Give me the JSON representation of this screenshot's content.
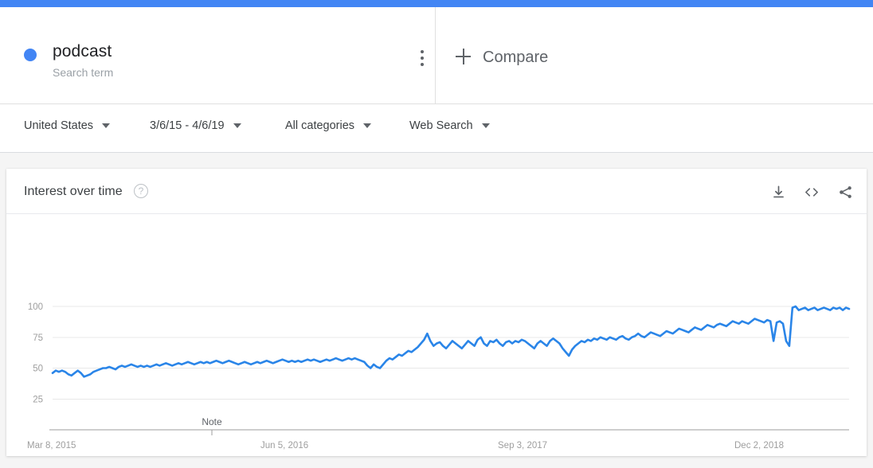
{
  "theme": {
    "accent": "#4285f4",
    "line_color": "#2a85e8",
    "page_bg": "#f5f5f5",
    "card_bg": "#ffffff",
    "grid_color": "#e8e8e8",
    "muted_text": "#9e9e9e"
  },
  "search_term": {
    "name": "podcast",
    "subtitle": "Search term",
    "dot_color": "#4285f4",
    "menu_icon": "three-dots-vertical-icon"
  },
  "compare": {
    "label": "Compare",
    "icon": "plus-icon"
  },
  "filters": [
    {
      "id": "region",
      "label": "United States",
      "icon": "chevron-down-icon"
    },
    {
      "id": "time",
      "label": "3/6/15 - 4/6/19",
      "icon": "chevron-down-icon"
    },
    {
      "id": "category",
      "label": "All categories",
      "icon": "chevron-down-icon"
    },
    {
      "id": "type",
      "label": "Web Search",
      "icon": "chevron-down-icon"
    }
  ],
  "card": {
    "title": "Interest over time",
    "help_icon": "question-mark-circle-icon",
    "help_glyph": "?",
    "actions": [
      {
        "id": "download",
        "icon": "download-icon",
        "tooltip": "Download"
      },
      {
        "id": "embed",
        "icon": "embed-code-icon",
        "tooltip": "Embed"
      },
      {
        "id": "share",
        "icon": "share-icon",
        "tooltip": "Share"
      }
    ]
  },
  "chart_data": {
    "type": "line",
    "title": "Interest over time",
    "xlabel": "",
    "ylabel": "",
    "ylim": [
      0,
      100
    ],
    "yticks": [
      25,
      50,
      75,
      100
    ],
    "ytick_labels": [
      "25",
      "75",
      "50",
      "100"
    ],
    "grid": true,
    "legend": false,
    "series_name": "podcast",
    "x_tick_labels": [
      "Mar 8, 2015",
      "Jun 5, 2016",
      "Sep 3, 2017",
      "Dec 2, 2018"
    ],
    "x_tick_positions": [
      0,
      0.295,
      0.593,
      0.89
    ],
    "x_range": [
      "Mar 8, 2015",
      "Apr 6, 2019"
    ],
    "annotations": [
      {
        "label": "Note",
        "x_fraction": 0.2
      }
    ],
    "values": [
      46,
      48,
      47,
      48,
      47,
      45,
      44,
      46,
      48,
      46,
      43,
      44,
      45,
      47,
      48,
      49,
      50,
      50,
      51,
      50,
      49,
      51,
      52,
      51,
      52,
      53,
      52,
      51,
      52,
      51,
      52,
      51,
      52,
      53,
      52,
      53,
      54,
      53,
      52,
      53,
      54,
      53,
      54,
      55,
      54,
      53,
      54,
      55,
      54,
      55,
      54,
      55,
      56,
      55,
      54,
      55,
      56,
      55,
      54,
      53,
      54,
      55,
      54,
      53,
      54,
      55,
      54,
      55,
      56,
      55,
      54,
      55,
      56,
      57,
      56,
      55,
      56,
      55,
      56,
      55,
      56,
      57,
      56,
      57,
      56,
      55,
      56,
      57,
      56,
      57,
      58,
      57,
      56,
      57,
      58,
      57,
      58,
      57,
      56,
      55,
      52,
      50,
      53,
      51,
      50,
      53,
      56,
      58,
      57,
      59,
      61,
      60,
      62,
      64,
      63,
      65,
      67,
      70,
      73,
      78,
      72,
      68,
      70,
      71,
      68,
      66,
      69,
      72,
      70,
      68,
      66,
      69,
      72,
      70,
      68,
      73,
      75,
      70,
      68,
      72,
      71,
      73,
      70,
      68,
      71,
      72,
      70,
      72,
      71,
      73,
      72,
      70,
      68,
      66,
      70,
      72,
      70,
      68,
      72,
      74,
      72,
      70,
      66,
      63,
      60,
      65,
      68,
      70,
      72,
      71,
      73,
      72,
      74,
      73,
      75,
      74,
      73,
      75,
      74,
      73,
      75,
      76,
      74,
      73,
      75,
      76,
      78,
      76,
      75,
      77,
      79,
      78,
      77,
      76,
      78,
      80,
      79,
      78,
      80,
      82,
      81,
      80,
      79,
      81,
      83,
      82,
      81,
      83,
      85,
      84,
      83,
      85,
      86,
      85,
      84,
      86,
      88,
      87,
      86,
      88,
      87,
      86,
      88,
      90,
      89,
      88,
      87,
      89,
      88,
      72,
      87,
      88,
      86,
      72,
      68,
      99,
      100,
      97,
      98,
      99,
      97,
      98,
      99,
      97,
      98,
      99,
      98,
      97,
      99,
      98,
      99,
      97,
      99,
      98
    ],
    "y_axis_max_label": "100",
    "description": "Google Trends interest over time for the search term 'podcast' in the United States, weekly, rising from around 46 in March 2015 to near 100 in April 2019."
  }
}
